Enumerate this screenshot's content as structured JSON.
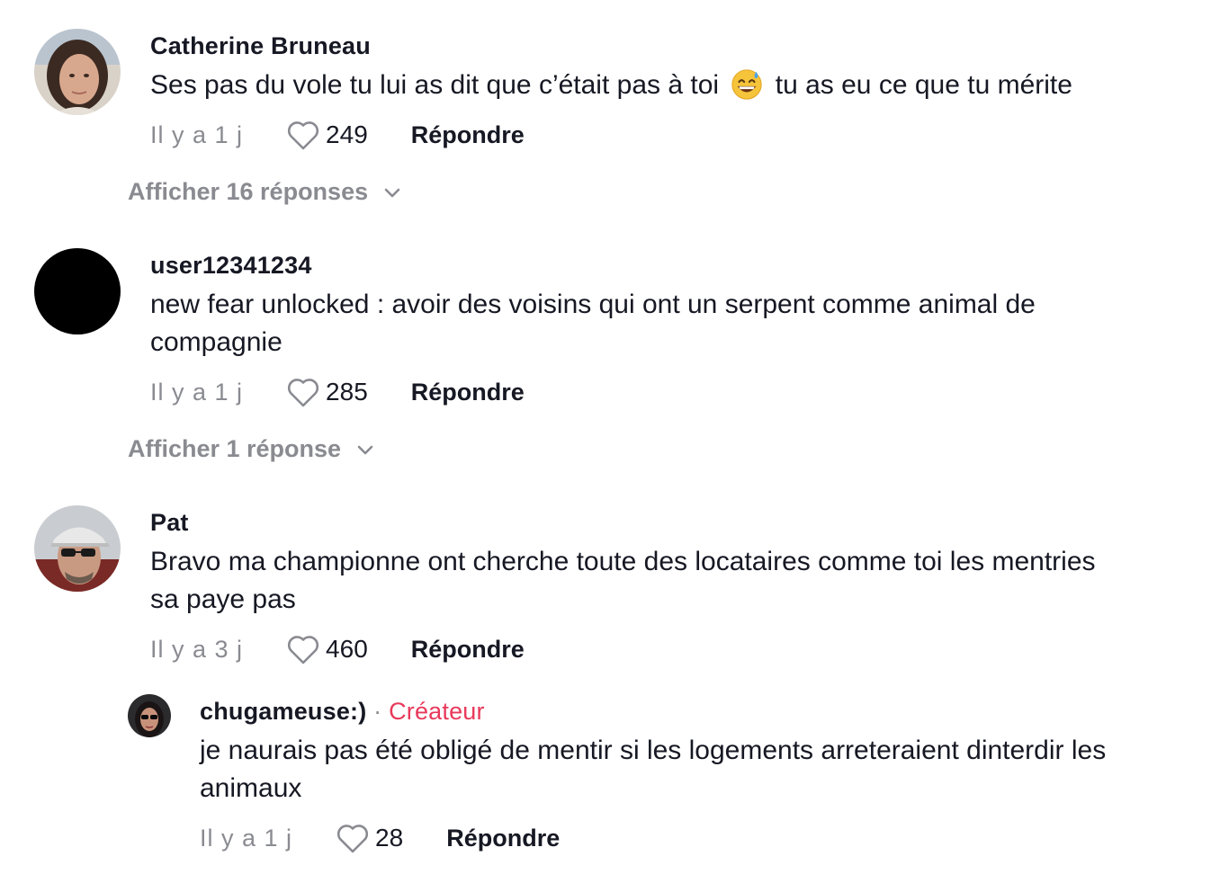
{
  "comments": [
    {
      "username": "Catherine Bruneau",
      "text_before_emoji": "Ses pas du vole tu lui as dit que c’était pas à toi",
      "emoji": "grinning-face-with-sweat",
      "text_after_emoji": "tu as eu ce que tu mérite",
      "time": "Il y a 1 j",
      "likes": "249",
      "reply_label": "Répondre",
      "view_replies": "Afficher 16 réponses"
    },
    {
      "username": "user12341234",
      "text": "new fear unlocked : avoir des voisins qui ont un serpent comme animal de compagnie",
      "time": "Il y a 1 j",
      "likes": "285",
      "reply_label": "Répondre",
      "view_replies": "Afficher 1 réponse"
    },
    {
      "username": "Pat",
      "text": "Bravo ma championne ont cherche toute des locataires comme toi les mentries sa paye pas",
      "time": "Il y a 3 j",
      "likes": "460",
      "reply_label": "Répondre",
      "replies": [
        {
          "username": "chugameuse:)",
          "separator": "·",
          "badge": "Créateur",
          "text": "je naurais pas été obligé de mentir si les logements arreteraient dinterdir les animaux",
          "time": "Il y a 1 j",
          "likes": "28",
          "reply_label": "Répondre"
        }
      ]
    }
  ],
  "icons": {
    "like": "heart-outline-icon",
    "expand": "chevron-down-icon"
  },
  "colors": {
    "text": "#161823",
    "muted": "#8a8b91",
    "creator_badge": "#e8395a",
    "background": "#ffffff"
  }
}
